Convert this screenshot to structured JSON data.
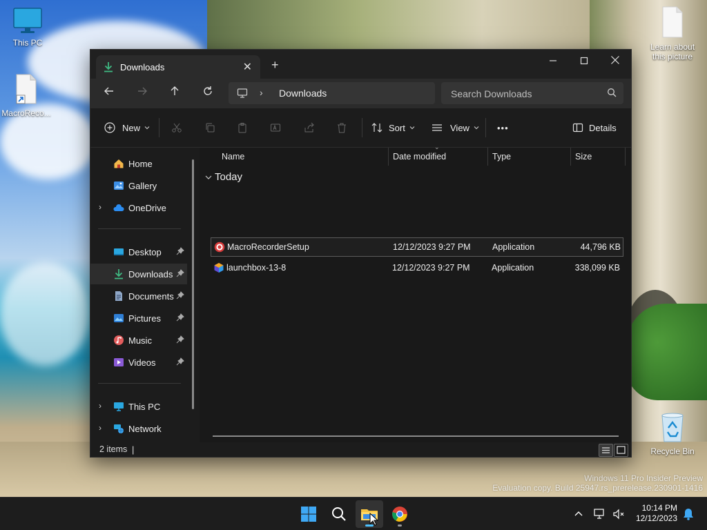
{
  "desktop": {
    "icons": [
      {
        "label": "This PC"
      },
      {
        "label": "MacroReco..."
      },
      {
        "label": "Learn about this picture"
      },
      {
        "label": "Recycle Bin"
      }
    ],
    "watermark": {
      "line1": "Windows 11 Pro Insider Preview",
      "line2": "Evaluation copy. Build 25947.rs_prerelease.230901-1416"
    }
  },
  "window": {
    "tab_title": "Downloads",
    "new_tab": "+",
    "address": {
      "segment": "Downloads"
    },
    "search": {
      "placeholder": "Search Downloads"
    },
    "toolbar": {
      "new_label": "New",
      "sort_label": "Sort",
      "view_label": "View",
      "more_label": "•••",
      "details_label": "Details"
    },
    "sidebar": {
      "items": [
        {
          "label": "Home"
        },
        {
          "label": "Gallery"
        },
        {
          "label": "OneDrive"
        },
        {
          "label": "Desktop"
        },
        {
          "label": "Downloads"
        },
        {
          "label": "Documents"
        },
        {
          "label": "Pictures"
        },
        {
          "label": "Music"
        },
        {
          "label": "Videos"
        },
        {
          "label": "This PC"
        },
        {
          "label": "Network"
        }
      ]
    },
    "columns": [
      "Name",
      "Date modified",
      "Type",
      "Size"
    ],
    "group": "Today",
    "files": [
      {
        "name": "MacroRecorderSetup",
        "date": "12/12/2023 9:27 PM",
        "type": "Application",
        "size": "44,796 KB"
      },
      {
        "name": "launchbox-13-8",
        "date": "12/12/2023 9:27 PM",
        "type": "Application",
        "size": "338,099 KB"
      }
    ],
    "status": {
      "count": "2 items",
      "caret": "|"
    }
  },
  "taskbar": {
    "time": "10:14 PM",
    "date": "12/12/2023"
  },
  "colors": {
    "accent": "#4cc2ff",
    "window_bg": "#1c1c1c",
    "download_green": "#3fb982"
  }
}
